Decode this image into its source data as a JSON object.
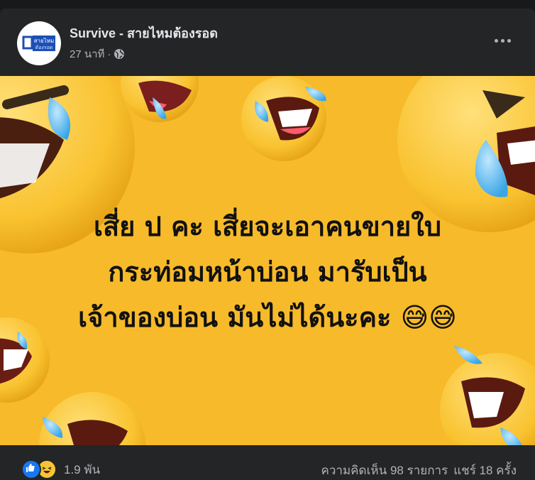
{
  "post": {
    "page_name": "Survive - สายไหมต้องรอด",
    "time": "27 นาที",
    "separator": "·",
    "avatar_text_top": "สายไหม",
    "avatar_text_bottom": "ต้องรอด",
    "privacy_icon": "globe-icon",
    "menu_icon": "more-horizontal-icon"
  },
  "image": {
    "background_color": "#f7ba2a",
    "lines": [
      "เสี่ย ป คะ เสี่ยจะเอาคนขายใบ",
      "กระท่อมหน้าบ่อน มารับเป็น",
      "เจ้าของบ่อน มันไม่ได้นะคะ 😅😅"
    ]
  },
  "footer": {
    "reaction_icons": [
      "like-icon",
      "haha-icon"
    ],
    "reaction_count": "1.9 พัน",
    "comments": "ความคิดเห็น 98 รายการ",
    "shares": "แชร์ 18 ครั้ง"
  },
  "colors": {
    "card": "#242526",
    "page_bg": "#18191a",
    "text_primary": "#e4e6eb",
    "text_secondary": "#b0b3b8",
    "like_blue": "#1877f2"
  }
}
